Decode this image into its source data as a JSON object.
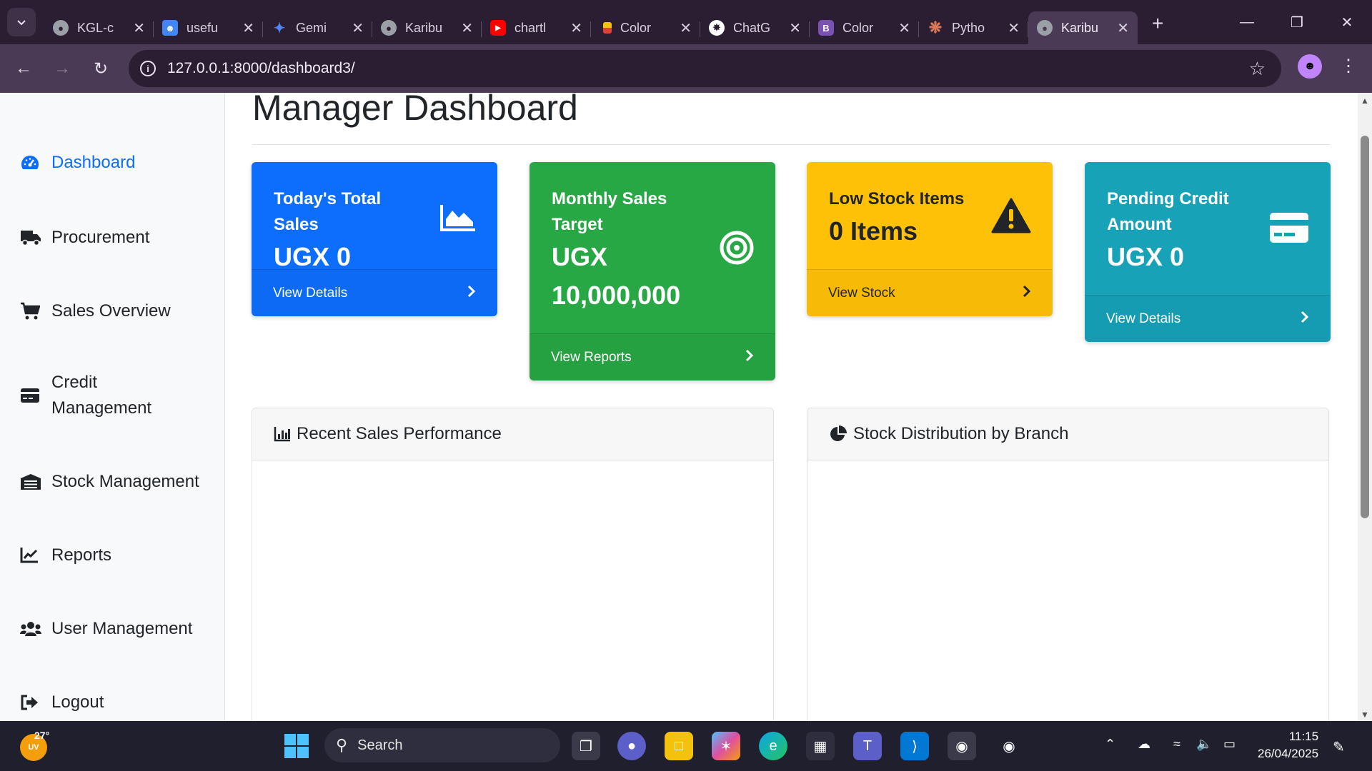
{
  "browser": {
    "tabs": [
      {
        "title": "KGL-c",
        "favicon": "globe-icon",
        "color": "#9aa0a6"
      },
      {
        "title": "usefu",
        "favicon": "contacts-icon",
        "color": "#4285f4"
      },
      {
        "title": "Gemi",
        "favicon": "gemini-icon",
        "color": "#4e86f7"
      },
      {
        "title": "Karibu",
        "favicon": "globe-icon",
        "color": "#9aa0a6"
      },
      {
        "title": "chartl",
        "favicon": "youtube-icon",
        "color": "#ff0000"
      },
      {
        "title": "Color",
        "favicon": "palette-icon",
        "color": "#f4c20d"
      },
      {
        "title": "ChatG",
        "favicon": "openai-icon",
        "color": "#ffffff"
      },
      {
        "title": "Color",
        "favicon": "bootstrap-icon",
        "color": "#7952b3"
      },
      {
        "title": "Pytho",
        "favicon": "claude-icon",
        "color": "#d97757"
      },
      {
        "title": "Karibu",
        "favicon": "globe-icon",
        "color": "#9aa0a6",
        "active": true
      }
    ],
    "url": "127.0.0.1:8000/dashboard3/"
  },
  "sidebar": {
    "items": [
      {
        "label": "Dashboard",
        "icon": "gauge-icon",
        "active": true
      },
      {
        "label": "Procurement",
        "icon": "truck-icon"
      },
      {
        "label": "Sales Overview",
        "icon": "cart-icon"
      },
      {
        "label": "Credit Management",
        "icon": "credit-card-icon"
      },
      {
        "label": "Stock Management",
        "icon": "warehouse-icon"
      },
      {
        "label": "Reports",
        "icon": "chart-line-icon"
      },
      {
        "label": "User Management",
        "icon": "users-icon"
      },
      {
        "label": "Logout",
        "icon": "logout-icon"
      }
    ]
  },
  "main": {
    "title": "Manager Dashboard",
    "cards": [
      {
        "title": "Today's Total Sales",
        "value": "UGX 0",
        "footer": "View Details",
        "icon": "chart-area-icon",
        "color": "#0d6efd"
      },
      {
        "title": "Monthly Sales Target",
        "value": "UGX 10,000,000",
        "footer": "View Reports",
        "icon": "bullseye-icon",
        "color": "#28a745"
      },
      {
        "title": "Low Stock Items",
        "value": "0 Items",
        "footer": "View Stock",
        "icon": "warning-icon",
        "color": "#ffc107"
      },
      {
        "title": "Pending Credit Amount",
        "value": "UGX 0",
        "footer": "View Details",
        "icon": "credit-card-icon",
        "color": "#17a2b8"
      }
    ],
    "panels": [
      {
        "title": "Recent Sales Performance",
        "icon": "bar-chart-icon"
      },
      {
        "title": "Stock Distribution by Branch",
        "icon": "pie-chart-icon"
      }
    ]
  },
  "taskbar": {
    "weather": "27°",
    "weather_badge": "UV",
    "search_placeholder": "Search",
    "time": "11:15",
    "date": "26/04/2025"
  }
}
